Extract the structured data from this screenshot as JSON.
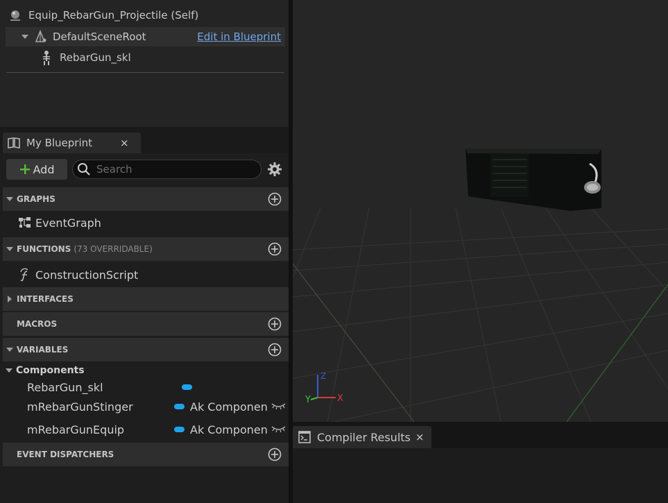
{
  "components_tree": {
    "self_label": "Equip_RebarGun_Projectile (Self)",
    "root_label": "DefaultSceneRoot",
    "edit_link": "Edit in Blueprint",
    "child_label": "RebarGun_skl"
  },
  "my_blueprint": {
    "tab_title": "My Blueprint",
    "close_glyph": "×",
    "add_label": "Add",
    "search_placeholder": "Search",
    "sections": {
      "graphs": "GRAPHS",
      "functions": "FUNCTIONS",
      "functions_note": "(73 OVERRIDABLE)",
      "interfaces": "INTERFACES",
      "macros": "MACROS",
      "variables": "VARIABLES",
      "event_dispatchers": "EVENT DISPATCHERS"
    },
    "graph_items": [
      "EventGraph"
    ],
    "function_items": [
      "ConstructionScript"
    ],
    "variables": {
      "category": "Components",
      "items": [
        {
          "name": "RebarGun_skl",
          "type": ""
        },
        {
          "name": "mRebarGunStinger",
          "type": "Ak Componen"
        },
        {
          "name": "mRebarGunEquip",
          "type": "Ak Componen"
        }
      ]
    }
  },
  "viewport": {
    "axis_labels": {
      "z": "Z",
      "x": "X",
      "y": "Y"
    }
  },
  "compiler": {
    "tab_title": "Compiler Results",
    "close_glyph": "×"
  },
  "colors": {
    "link": "#73a6e8",
    "variable_pill": "#1da3ea",
    "add_plus": "#5bbd3a",
    "axis_x": "#d23c3c",
    "axis_y": "#3cc23c",
    "axis_z": "#3c5ad2"
  }
}
